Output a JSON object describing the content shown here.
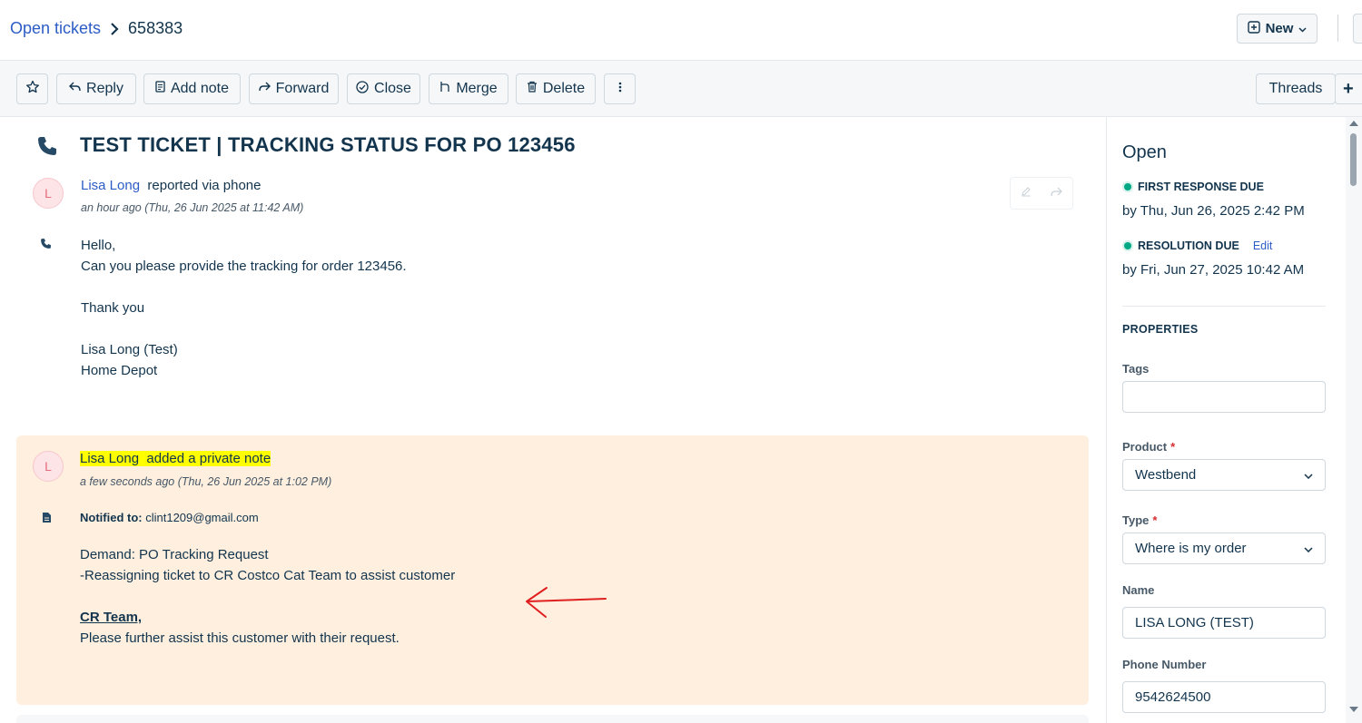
{
  "header": {
    "breadcrumb_link": "Open tickets",
    "ticket_id": "658383",
    "new_label": "New"
  },
  "toolbar": {
    "reply": "Reply",
    "add_note": "Add note",
    "forward": "Forward",
    "close": "Close",
    "merge": "Merge",
    "delete": "Delete",
    "threads": "Threads",
    "plus": "+"
  },
  "ticket": {
    "subject": "TEST TICKET | TRACKING STATUS FOR PO 123456",
    "original": {
      "avatar": "L",
      "author": "Lisa Long",
      "action": "reported via phone",
      "time": "an hour ago (Thu, 26 Jun 2025 at 11:42 AM)",
      "lines": [
        "Hello,",
        "Can you please provide the tracking for order 123456.",
        "",
        "Thank you",
        "",
        "Lisa Long (Test)",
        "Home Depot"
      ]
    },
    "note": {
      "avatar": "L",
      "author": "Lisa Long",
      "action": "added a private note",
      "time": "a few seconds ago (Thu, 26 Jun 2025 at 1:02 PM)",
      "notified_label": "Notified to:",
      "notified_email": "clint1209@gmail.com",
      "line1": "Demand: PO Tracking Request",
      "line2": "-Reassigning ticket to CR Costco Cat Team to assist customer",
      "team_heading": "CR Team,",
      "line3": "Please further assist this customer with their request."
    }
  },
  "sidebar": {
    "status": "Open",
    "first_response_label": "FIRST RESPONSE DUE",
    "first_response_value": "by Thu, Jun 26, 2025 2:42 PM",
    "resolution_label": "RESOLUTION DUE",
    "resolution_edit": "Edit",
    "resolution_value": "by Fri, Jun 27, 2025 10:42 AM",
    "properties_heading": "PROPERTIES",
    "tags_label": "Tags",
    "tags_value": "",
    "product_label": "Product",
    "product_value": "Westbend",
    "type_label": "Type",
    "type_value": "Where is my order",
    "name_label": "Name",
    "name_value": "LISA LONG (TEST)",
    "phone_label": "Phone Number",
    "phone_value": "9542624500",
    "required_mark": "*"
  },
  "colors": {
    "accent": "#2c5cc5",
    "note_bg": "#ffefdf",
    "highlight": "#ffff00",
    "annotation_arrow": "#e02020",
    "sla_ok": "#00a886"
  }
}
